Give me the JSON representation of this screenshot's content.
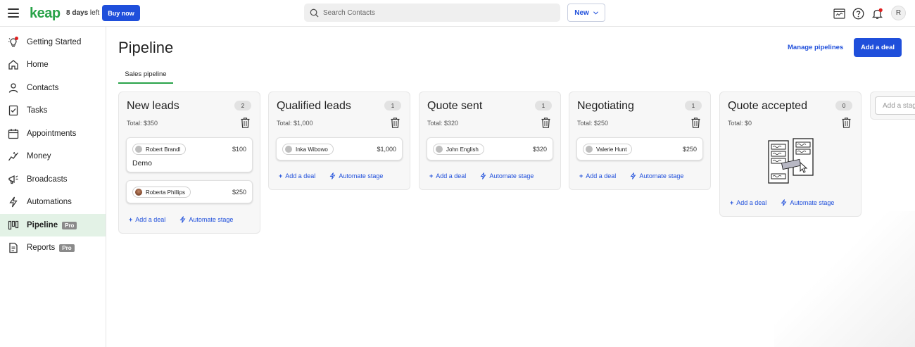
{
  "header": {
    "logo": "keap",
    "trial_days": "8 days",
    "trial_suffix": " left",
    "buy_label": "Buy now",
    "search_placeholder": "Search Contacts",
    "new_label": "New",
    "avatar_initial": "R"
  },
  "sidebar": {
    "items": [
      {
        "label": "Getting Started",
        "icon": "lightbulb-icon"
      },
      {
        "label": "Home",
        "icon": "home-icon"
      },
      {
        "label": "Contacts",
        "icon": "person-icon"
      },
      {
        "label": "Tasks",
        "icon": "checklist-icon"
      },
      {
        "label": "Appointments",
        "icon": "calendar-icon"
      },
      {
        "label": "Money",
        "icon": "money-icon"
      },
      {
        "label": "Broadcasts",
        "icon": "megaphone-icon"
      },
      {
        "label": "Automations",
        "icon": "lightning-icon"
      },
      {
        "label": "Pipeline",
        "icon": "pipeline-icon",
        "badge": "Pro"
      },
      {
        "label": "Reports",
        "icon": "report-icon",
        "badge": "Pro"
      }
    ]
  },
  "main": {
    "title": "Pipeline",
    "manage_label": "Manage pipelines",
    "add_deal_label": "Add a deal",
    "tab_label": "Sales pipeline",
    "add_stage_placeholder": "Add a stage",
    "stages": [
      {
        "name": "New leads",
        "count": "2",
        "total": "Total: $350",
        "deals": [
          {
            "contact": "Robert Brandl",
            "amount": "$100",
            "name": "Demo"
          },
          {
            "contact": "Roberta Phillips",
            "amount": "$250",
            "name": ""
          }
        ]
      },
      {
        "name": "Qualified leads",
        "count": "1",
        "total": "Total: $1,000",
        "deals": [
          {
            "contact": "Inka Wibowo",
            "amount": "$1,000",
            "name": ""
          }
        ]
      },
      {
        "name": "Quote sent",
        "count": "1",
        "total": "Total: $320",
        "deals": [
          {
            "contact": "John English",
            "amount": "$320",
            "name": ""
          }
        ]
      },
      {
        "name": "Negotiating",
        "count": "1",
        "total": "Total: $250",
        "deals": [
          {
            "contact": "Valerie Hunt",
            "amount": "$250",
            "name": ""
          }
        ]
      },
      {
        "name": "Quote accepted",
        "count": "0",
        "total": "Total: $0",
        "deals": []
      }
    ],
    "stage_add_deal": "Add a deal",
    "stage_automate": "Automate stage"
  },
  "colors": {
    "brand": "#2aa34a",
    "accent": "#1f4fdb"
  }
}
